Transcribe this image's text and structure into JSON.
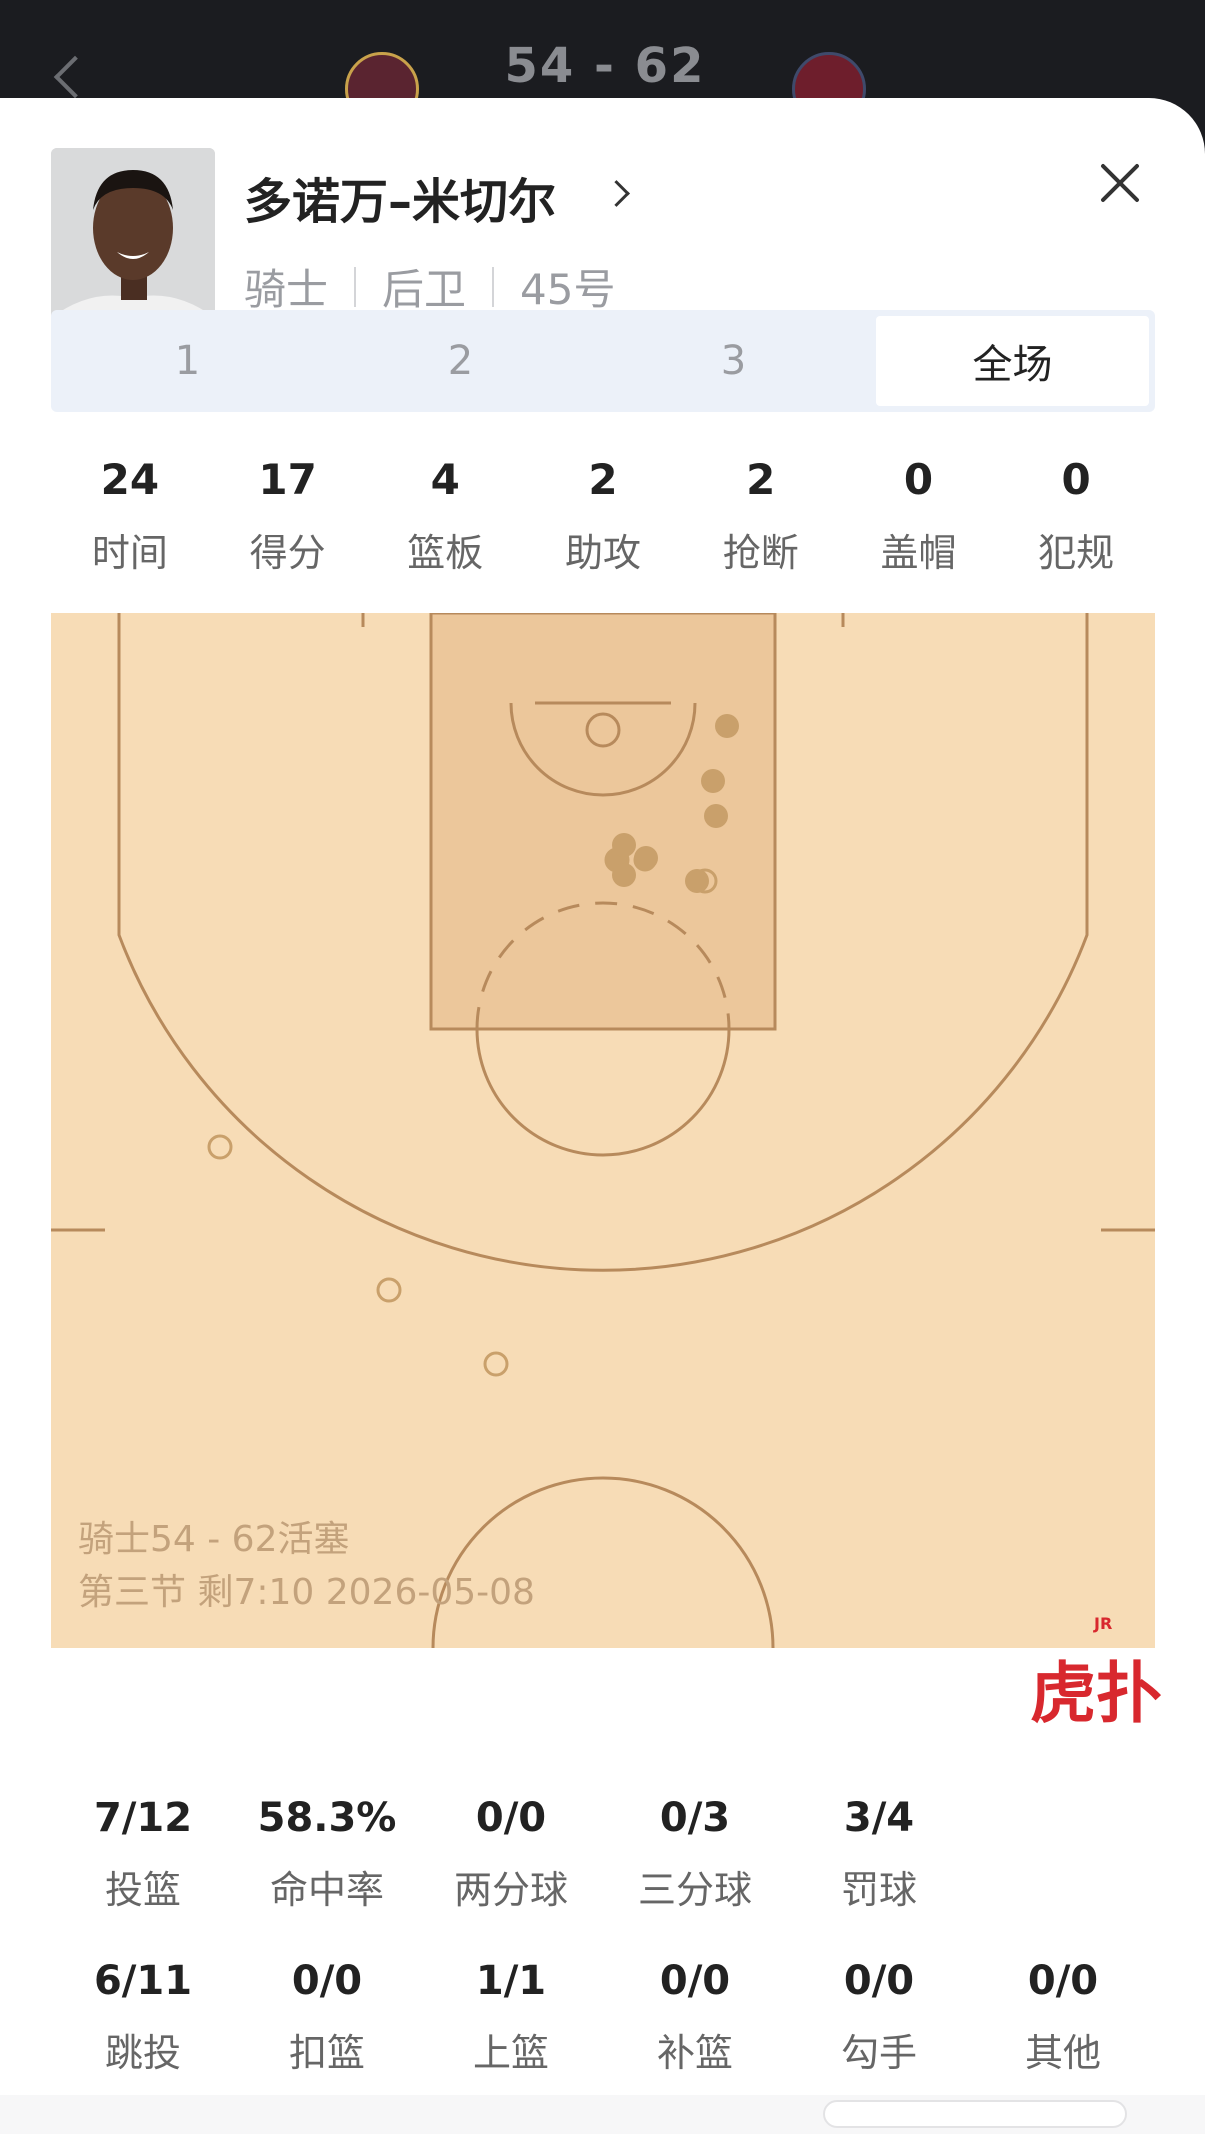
{
  "header": {
    "score": "54 - 62",
    "left_team_icon": "cavaliers-logo",
    "right_team_icon": "pistons-logo"
  },
  "player": {
    "name": "多诺万–米切尔",
    "team": "骑士",
    "position": "后卫",
    "number": "45号"
  },
  "tabs": [
    {
      "label": "1",
      "active": false
    },
    {
      "label": "2",
      "active": false
    },
    {
      "label": "3",
      "active": false
    },
    {
      "label": "全场",
      "active": true
    }
  ],
  "summary_stats": [
    {
      "value": "24",
      "label": "时间"
    },
    {
      "value": "17",
      "label": "得分"
    },
    {
      "value": "4",
      "label": "篮板"
    },
    {
      "value": "2",
      "label": "助攻"
    },
    {
      "value": "2",
      "label": "抢断"
    },
    {
      "value": "0",
      "label": "盖帽"
    },
    {
      "value": "0",
      "label": "犯规"
    }
  ],
  "court": {
    "caption_line1": "骑士54 - 62活塞",
    "caption_line2": "第三节 剩7:10 2026-05-08",
    "brand": "虎扑",
    "brand_small": "JR",
    "floor_color": "#f7dcb6",
    "made_color": "#c9a06b",
    "missed_color": "#c9a06b"
  },
  "shot_stats_row1": [
    {
      "value": "7/12",
      "label": "投篮"
    },
    {
      "value": "58.3%",
      "label": "命中率"
    },
    {
      "value": "0/0",
      "label": "两分球"
    },
    {
      "value": "0/3",
      "label": "三分球"
    },
    {
      "value": "3/4",
      "label": "罚球"
    }
  ],
  "shot_stats_row2": [
    {
      "value": "6/11",
      "label": "跳投"
    },
    {
      "value": "0/0",
      "label": "扣篮"
    },
    {
      "value": "1/1",
      "label": "上篮"
    },
    {
      "value": "0/0",
      "label": "补篮"
    },
    {
      "value": "0/0",
      "label": "勾手"
    },
    {
      "value": "0/0",
      "label": "其他"
    }
  ]
}
